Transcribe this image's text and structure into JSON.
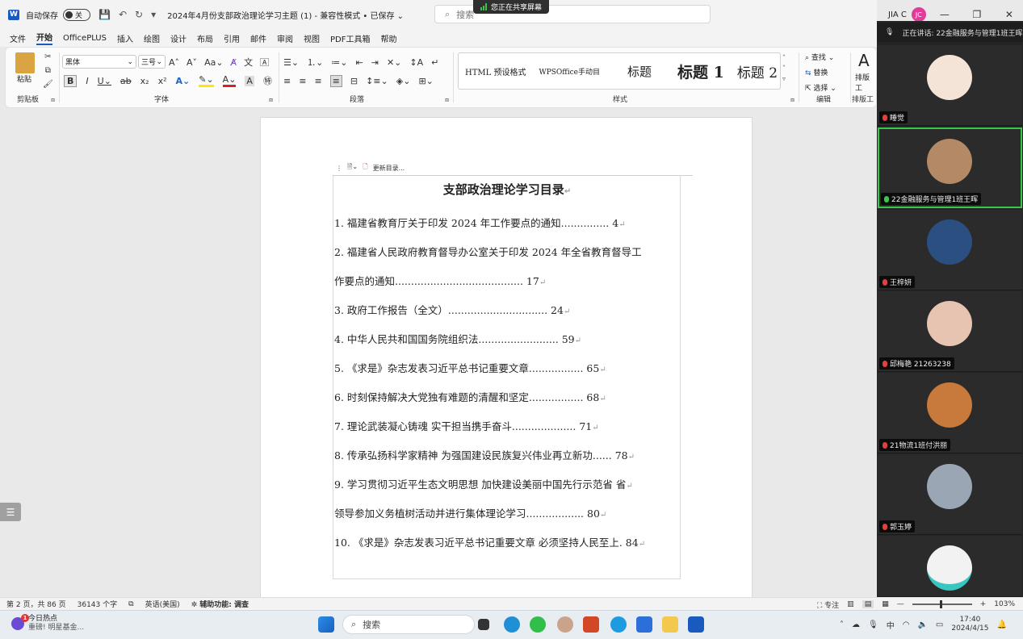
{
  "titlebar": {
    "autosave_label": "自动保存",
    "autosave_state": "关",
    "doc_title": "2024年4月份支部政治理论学习主题 (1)  -  兼容性模式 • 已保存 ⌄",
    "search_placeholder": "搜索",
    "share_banner": "您正在共享屏幕",
    "user_name": "JIA C",
    "user_initials": "JC"
  },
  "menu": [
    "文件",
    "开始",
    "OfficePLUS",
    "插入",
    "绘图",
    "设计",
    "布局",
    "引用",
    "邮件",
    "审阅",
    "视图",
    "PDF工具箱",
    "帮助"
  ],
  "ribbon": {
    "paste_label": "粘贴",
    "clipboard_label": "剪贴板",
    "font_name": "黑体",
    "font_size": "三号",
    "font_label": "字体",
    "paragraph_label": "段落",
    "styles_label": "样式",
    "styles": [
      {
        "label": "HTML 预设格式",
        "size": "10px"
      },
      {
        "label": "WPSOffice手动目",
        "size": "9px"
      },
      {
        "label": "标题",
        "size": "15px"
      },
      {
        "label": "标题 1",
        "size": "19px"
      },
      {
        "label": "标题 2",
        "size": "17px"
      }
    ],
    "find_label": "查找",
    "replace_label": "替换",
    "select_label": "选择",
    "edit_label": "编辑",
    "layout_label": "排版工",
    "layout_group_label": "排版工"
  },
  "toc": {
    "update_label": "更新目录...",
    "title": "支部政治理论学习目录",
    "lines": [
      "1. 福建省教育厅关于印发 2024 年工作要点的通知............... 4",
      "2. 福建省人民政府教育督导办公室关于印发 2024 年全省教育督导工",
      "作要点的通知........................................ 17",
      "3. 政府工作报告（全文）............................... 24",
      "4. 中华人民共和国国务院组织法......................... 59",
      "5. 《求是》杂志发表习近平总书记重要文章................. 65",
      "6. 时刻保持解决大党独有难题的清醒和坚定................. 68",
      "7. 理论武装凝心铸魂  实干担当携手奋斗.................... 71",
      "8. 传承弘扬科学家精神  为强国建设民族复兴伟业再立新功...... 78",
      "9. 学习贯彻习近平生态文明思想  加快建设美丽中国先行示范省    省",
      "领导参加义务植树活动并进行集体理论学习.................. 80",
      "10. 《求是》杂志发表习近平总书记重要文章  必须坚持人民至上. 84"
    ]
  },
  "meeting": {
    "speaking": "正在讲话:   22金融服务与管理1班王晖",
    "participants": [
      {
        "name": "睡觉",
        "color": "#f3e4d7"
      },
      {
        "name": "22金融服务与管理1班王晖",
        "color": "#b48a66"
      },
      {
        "name": "王梓妍",
        "color": "#2b4f80"
      },
      {
        "name": "邱梅艳 21263238",
        "color": "#e7c3b2"
      },
      {
        "name": "21物流1班付洪丽",
        "color": "#c77a3c"
      },
      {
        "name": "郭玉婷",
        "color": "#9ba6b5"
      },
      {
        "name": "",
        "color": "#f2f2f2"
      }
    ]
  },
  "status": {
    "page": "第 2 页，共 86 页",
    "words": "36143 个字",
    "lang": "英语(美国)",
    "access": "辅助功能: 调查",
    "focus": "专注",
    "zoom": "103%"
  },
  "taskbar": {
    "news_title": "今日热点",
    "news_sub": "重磅! 明星基金...",
    "news_badge": "1",
    "search_label": "搜索",
    "ime": "中",
    "time": "17:40",
    "date": "2024/4/15"
  }
}
